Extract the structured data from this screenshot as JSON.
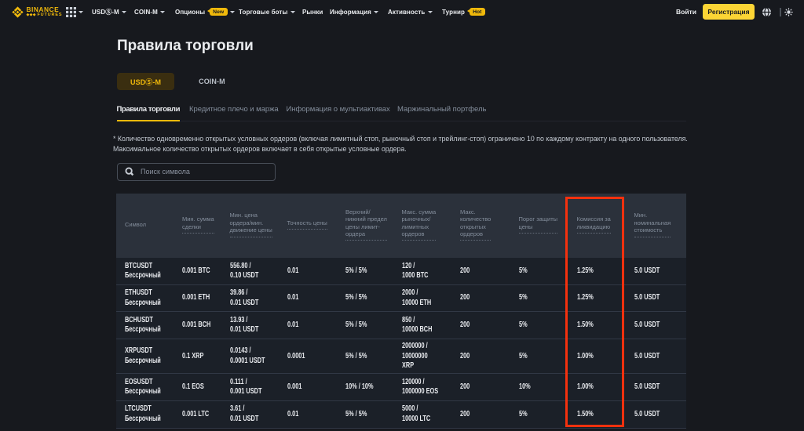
{
  "topbar": {
    "logo": {
      "brand": "BINANCE",
      "sub": "FUTURES"
    },
    "menu": [
      {
        "label": "USDⓈ-M"
      },
      {
        "label": "COIN-M"
      },
      {
        "label": "Опционы",
        "badge": "New"
      },
      {
        "label": "Торговые боты"
      },
      {
        "label": "Рынки"
      },
      {
        "label": "Информация"
      },
      {
        "label": "Активность"
      },
      {
        "label": "Турнир",
        "badge": "Hot"
      }
    ],
    "login_label": "Войти",
    "register_label": "Регистрация"
  },
  "page": {
    "title": "Правила торговли",
    "market_tabs": [
      {
        "label": "USDⓈ-M"
      },
      {
        "label": "COIN-M"
      }
    ],
    "section_tabs": [
      {
        "label": "Правила торговли"
      },
      {
        "label": "Кредитное плечо и маржа"
      },
      {
        "label": "Информация о мультиактивах"
      },
      {
        "label": "Маржинальный портфель"
      }
    ],
    "note_line1": "* Количество одновременно открытых условных ордеров (включая лимитный стоп, рыночный стоп и трейлинг-стоп) ограничено 10 по каждому контракту на одного пользователя.",
    "note_line2": "Максимальное количество открытых ордеров включает в себя открытые условные ордера.",
    "search_placeholder": "Поиск символа"
  },
  "table": {
    "columns": [
      "Символ",
      "Мин. сумма\nсделки",
      "Мин. цена\nордера/мин.\nдвижение цены",
      "Точность цены",
      "Верхний/\nнижний предел\nцены лимит-\nордера",
      "Макс. сумма\nрыночных/\nлимитных\nордеров",
      "Макс.\nколичество\nоткрытых\nордеров",
      "Порог защиты\nцены",
      "Комиссия за\nликвидацию",
      "Мин.\nноминальная\nстоимость"
    ],
    "rows": [
      {
        "cells": [
          "BTCUSDT\nБессрочный",
          "0.001 BTC",
          "556.80 /\n0.10 USDT",
          "0.01",
          "5% / 5%",
          "120 /\n1000 BTC",
          "200",
          "5%",
          "1.25%",
          "5.0 USDT"
        ]
      },
      {
        "cells": [
          "ETHUSDT\nБессрочный",
          "0.001 ETH",
          "39.86 /\n0.01 USDT",
          "0.01",
          "5% / 5%",
          "2000 /\n10000 ETH",
          "200",
          "5%",
          "1.25%",
          "5.0 USDT"
        ]
      },
      {
        "cells": [
          "BCHUSDT\nБессрочный",
          "0.001 BCH",
          "13.93 /\n0.01 USDT",
          "0.01",
          "5% / 5%",
          "850 /\n10000 BCH",
          "200",
          "5%",
          "1.50%",
          "5.0 USDT"
        ]
      },
      {
        "cells": [
          "XRPUSDT\nБессрочный",
          "0.1 XRP",
          "0.0143 /\n0.0001 USDT",
          "0.0001",
          "5% / 5%",
          "2000000 /\n10000000\nXRP",
          "200",
          "5%",
          "1.00%",
          "5.0 USDT"
        ]
      },
      {
        "cells": [
          "EOSUSDT\nБессрочный",
          "0.1 EOS",
          "0.111 /\n0.001 USDT",
          "0.001",
          "10% / 10%",
          "120000 /\n1000000 EOS",
          "200",
          "10%",
          "1.00%",
          "5.0 USDT"
        ]
      },
      {
        "cells": [
          "LTCUSDT\nБессрочный",
          "0.001 LTC",
          "3.61 /\n0.01 USDT",
          "0.01",
          "5% / 5%",
          "5000 /\n10000 LTC",
          "200",
          "5%",
          "1.50%",
          "5.0 USDT"
        ]
      }
    ]
  },
  "highlight": {
    "color": "#f5310e",
    "column": "Комиссия за ликвидацию"
  }
}
